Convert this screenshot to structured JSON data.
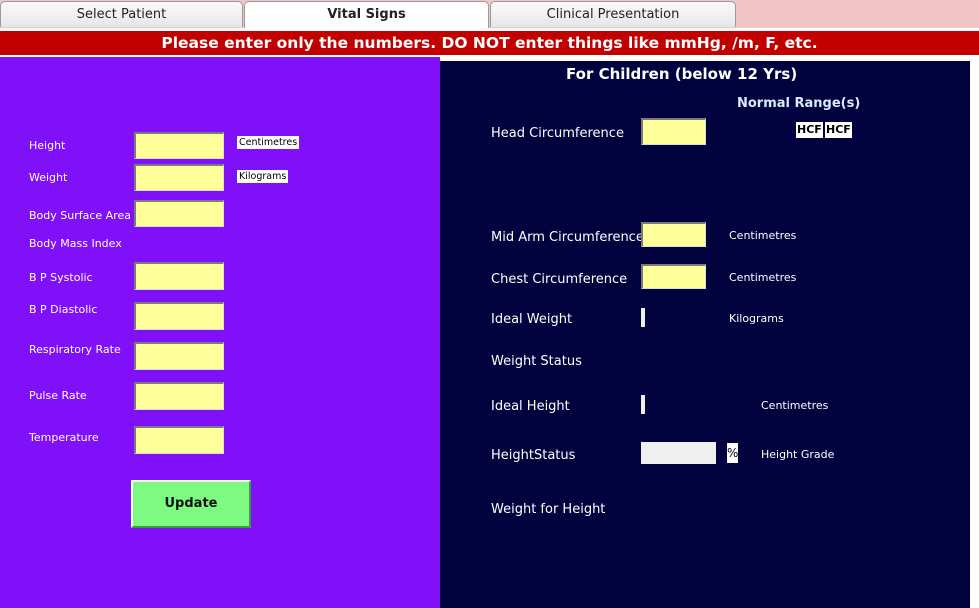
{
  "tabs": [
    {
      "label": "Select Patient"
    },
    {
      "label": "Vital Signs"
    },
    {
      "label": "Clinical Presentation"
    }
  ],
  "banner": "Please enter only the numbers. DO NOT enter things like mmHg, /m, F, etc.",
  "left": {
    "height_label": "Height",
    "height_unit": "Centimetres",
    "weight_label": "Weight",
    "weight_unit": "Kilograms",
    "bsa_label": "Body Surface Area",
    "bmi_label": "Body Mass Index",
    "bp_systolic_label": "B P Systolic",
    "bp_diastolic_label": "B P Diastolic",
    "resp_rate_label": "Respiratory Rate",
    "pulse_rate_label": "Pulse Rate",
    "temperature_label": "Temperature",
    "update_label": "Update"
  },
  "right": {
    "title": "For Children (below 12 Yrs)",
    "normal_range_title": "Normal Range(s)",
    "hcf_1": "HCF",
    "hcf_2": "HCF",
    "head_circ_label": "Head Circumference",
    "mid_arm_label": "Mid Arm Circumference",
    "mid_arm_unit": "Centimetres",
    "chest_label": "Chest Circumference",
    "chest_unit": "Centimetres",
    "ideal_weight_label": "Ideal Weight",
    "ideal_weight_unit": "Kilograms",
    "weight_status_label": "Weight Status",
    "ideal_height_label": "Ideal Height",
    "ideal_height_unit": "Centimetres",
    "height_status_label": "HeightStatus",
    "percent_symbol": "%",
    "height_grade_label": "Height Grade",
    "weight_for_height_label": "Weight for Height"
  },
  "colors": {
    "banner_bg": "#c20000",
    "left_panel_bg": "#8010f7",
    "right_panel_bg": "#02023e",
    "input_bg": "#ffff99",
    "update_button_bg": "#7dfa82"
  }
}
